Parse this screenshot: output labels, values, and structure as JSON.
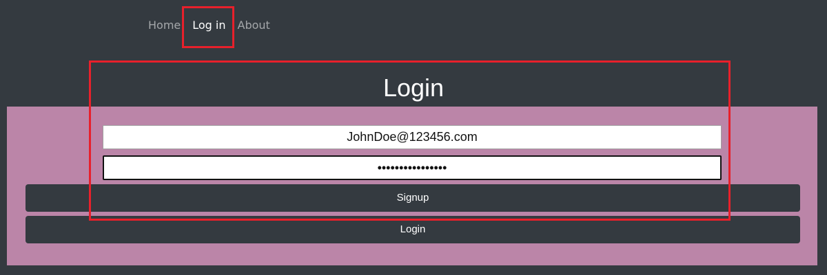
{
  "nav": {
    "items": [
      {
        "label": "Home",
        "active": false
      },
      {
        "label": "Log in",
        "active": true
      },
      {
        "label": "About",
        "active": false
      }
    ]
  },
  "page": {
    "title": "Login"
  },
  "form": {
    "email_value": "JohnDoe@123456.com",
    "password_value": "••••••••••••••••",
    "signup_label": "Signup",
    "login_label": "Login"
  },
  "colors": {
    "background": "#343a40",
    "panel": "#bb85a8",
    "highlight": "#e8202b"
  }
}
